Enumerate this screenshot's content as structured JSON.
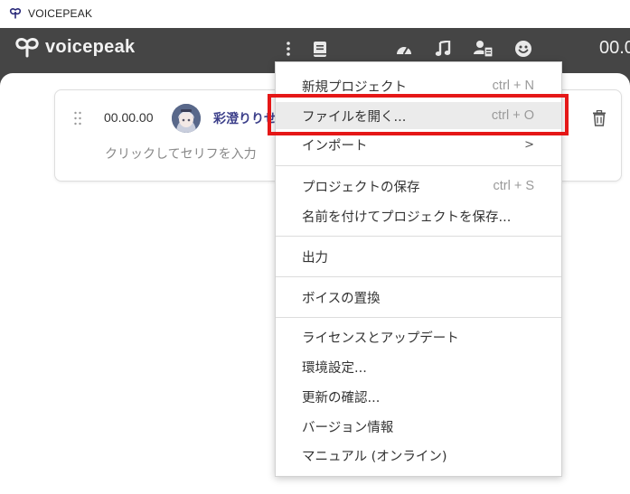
{
  "window": {
    "title": "VOICEPEAK"
  },
  "app": {
    "logo_text": "voicepeak",
    "time_display": "00.0"
  },
  "toolbar": {
    "icons": [
      "more-vertical-icon",
      "book-icon",
      "speedometer-icon",
      "music-note-icon",
      "voice-manager-icon",
      "emoji-icon"
    ]
  },
  "card": {
    "time": "00.00.00",
    "narrator": "彩澄りりせ",
    "placeholder": "クリックしてセリフを入力"
  },
  "menu": {
    "items": [
      {
        "label": "新規プロジェクト",
        "shortcut": "ctrl + N"
      },
      {
        "label": "ファイルを開く...",
        "shortcut": "ctrl + O"
      },
      {
        "label": "インポート",
        "shortcut": ">"
      },
      {
        "label": "プロジェクトの保存",
        "shortcut": "ctrl + S"
      },
      {
        "label": "名前を付けてプロジェクトを保存...",
        "shortcut": ""
      },
      {
        "label": "出力",
        "shortcut": ""
      },
      {
        "label": "ボイスの置換",
        "shortcut": ""
      },
      {
        "label": "ライセンスとアップデート",
        "shortcut": ""
      },
      {
        "label": "環境設定...",
        "shortcut": ""
      },
      {
        "label": "更新の確認...",
        "shortcut": ""
      },
      {
        "label": "バージョン情報",
        "shortcut": ""
      },
      {
        "label": "マニュアル (オンライン)",
        "shortcut": ""
      }
    ]
  },
  "colors": {
    "appbar": "#454545",
    "highlight": "#e51717",
    "narrator": "#3c3f8a",
    "hover": "#ebebeb"
  }
}
